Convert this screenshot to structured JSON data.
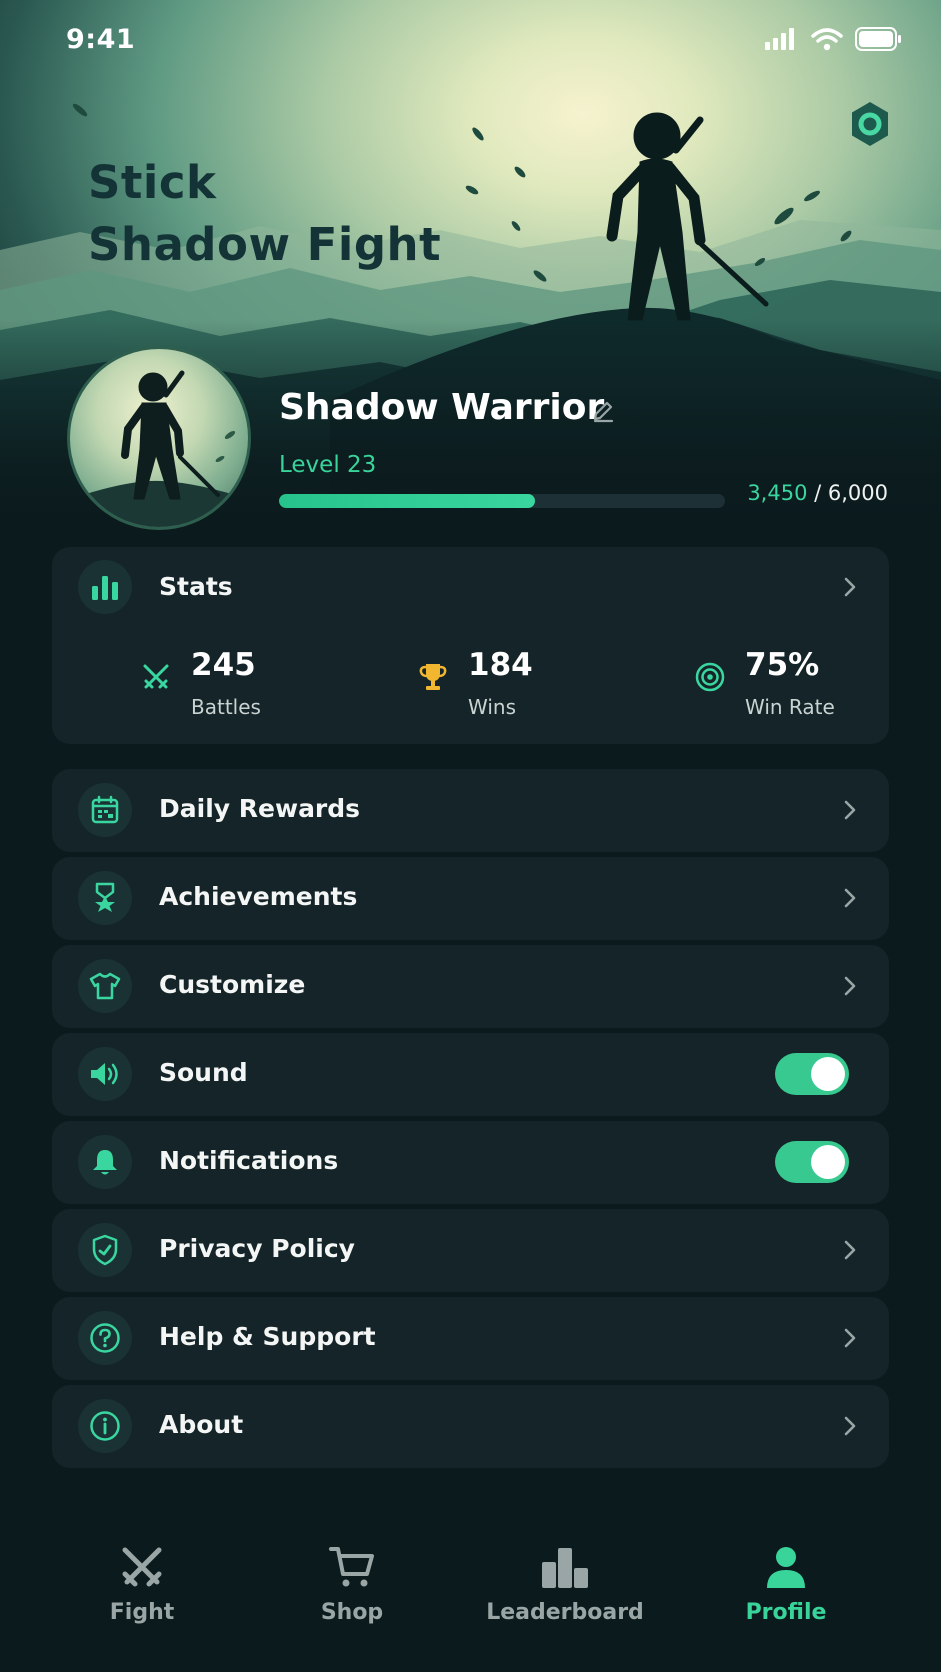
{
  "status_bar": {
    "time": "9:41"
  },
  "hero": {
    "title_line1": "Stick",
    "title_line2": "Shadow Fight"
  },
  "profile": {
    "name": "Shadow Warrior",
    "level": "Level 23",
    "xp_current": "3,450",
    "xp_separator": " / ",
    "xp_max": "6,000",
    "xp_progress": 0.575
  },
  "stats": {
    "title": "Stats",
    "items": [
      {
        "value": "245",
        "label": "Battles",
        "icon": "crossed-swords-icon"
      },
      {
        "value": "184",
        "label": "Wins",
        "icon": "trophy-icon"
      },
      {
        "value": "75%",
        "label": "Win Rate",
        "icon": "target-icon"
      }
    ]
  },
  "menu": {
    "daily_rewards": "Daily Rewards",
    "achievements": "Achievements",
    "customize": "Customize",
    "sound": "Sound",
    "sound_on": true,
    "notifications": "Notifications",
    "notifications_on": true,
    "privacy_policy": "Privacy Policy",
    "help_support": "Help & Support",
    "about": "About"
  },
  "nav": {
    "items": [
      {
        "label": "Fight",
        "icon": "crossed-swords-icon",
        "active": false
      },
      {
        "label": "Shop",
        "icon": "cart-icon",
        "active": false
      },
      {
        "label": "Leaderboard",
        "icon": "podium-icon",
        "active": false
      },
      {
        "label": "Profile",
        "icon": "person-icon",
        "active": true
      }
    ]
  },
  "colors": {
    "accent": "#38d49a",
    "background": "#0b1a1d",
    "card": "#142428",
    "trophy": "#f2b630"
  }
}
